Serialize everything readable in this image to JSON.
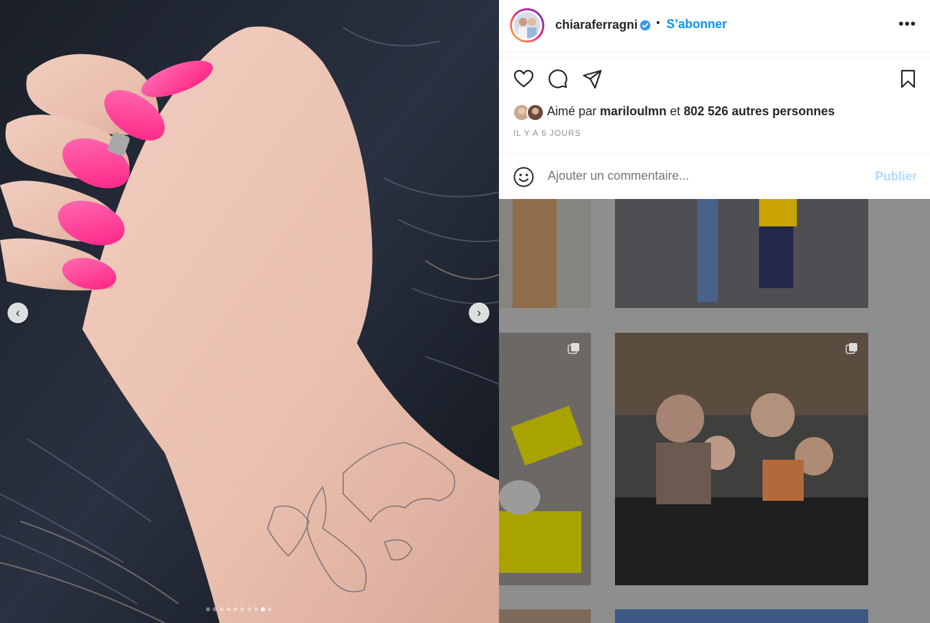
{
  "post": {
    "username": "chiaraferragni",
    "verified_icon": "verified-badge-icon",
    "separator": "•",
    "follow_label": "S’abonner",
    "more_label": "•••",
    "liked_prefix": "Aimé par",
    "liked_user": "mariloulmn",
    "liked_connector": "et",
    "liked_others": "802 526 autres personnes",
    "time_ago": "IL Y A 6 JOURS",
    "comment_placeholder": "Ajouter un commentaire...",
    "publish_label": "Publier"
  },
  "carousel": {
    "prev_label": "‹",
    "next_label": "›",
    "slide_count": 10,
    "active_slide": 9
  },
  "colors": {
    "accent": "#0095f6",
    "publish_disabled": "#b3dbff",
    "nail_pink": "#ff2d8a",
    "overlay": "#8e8e8e"
  }
}
